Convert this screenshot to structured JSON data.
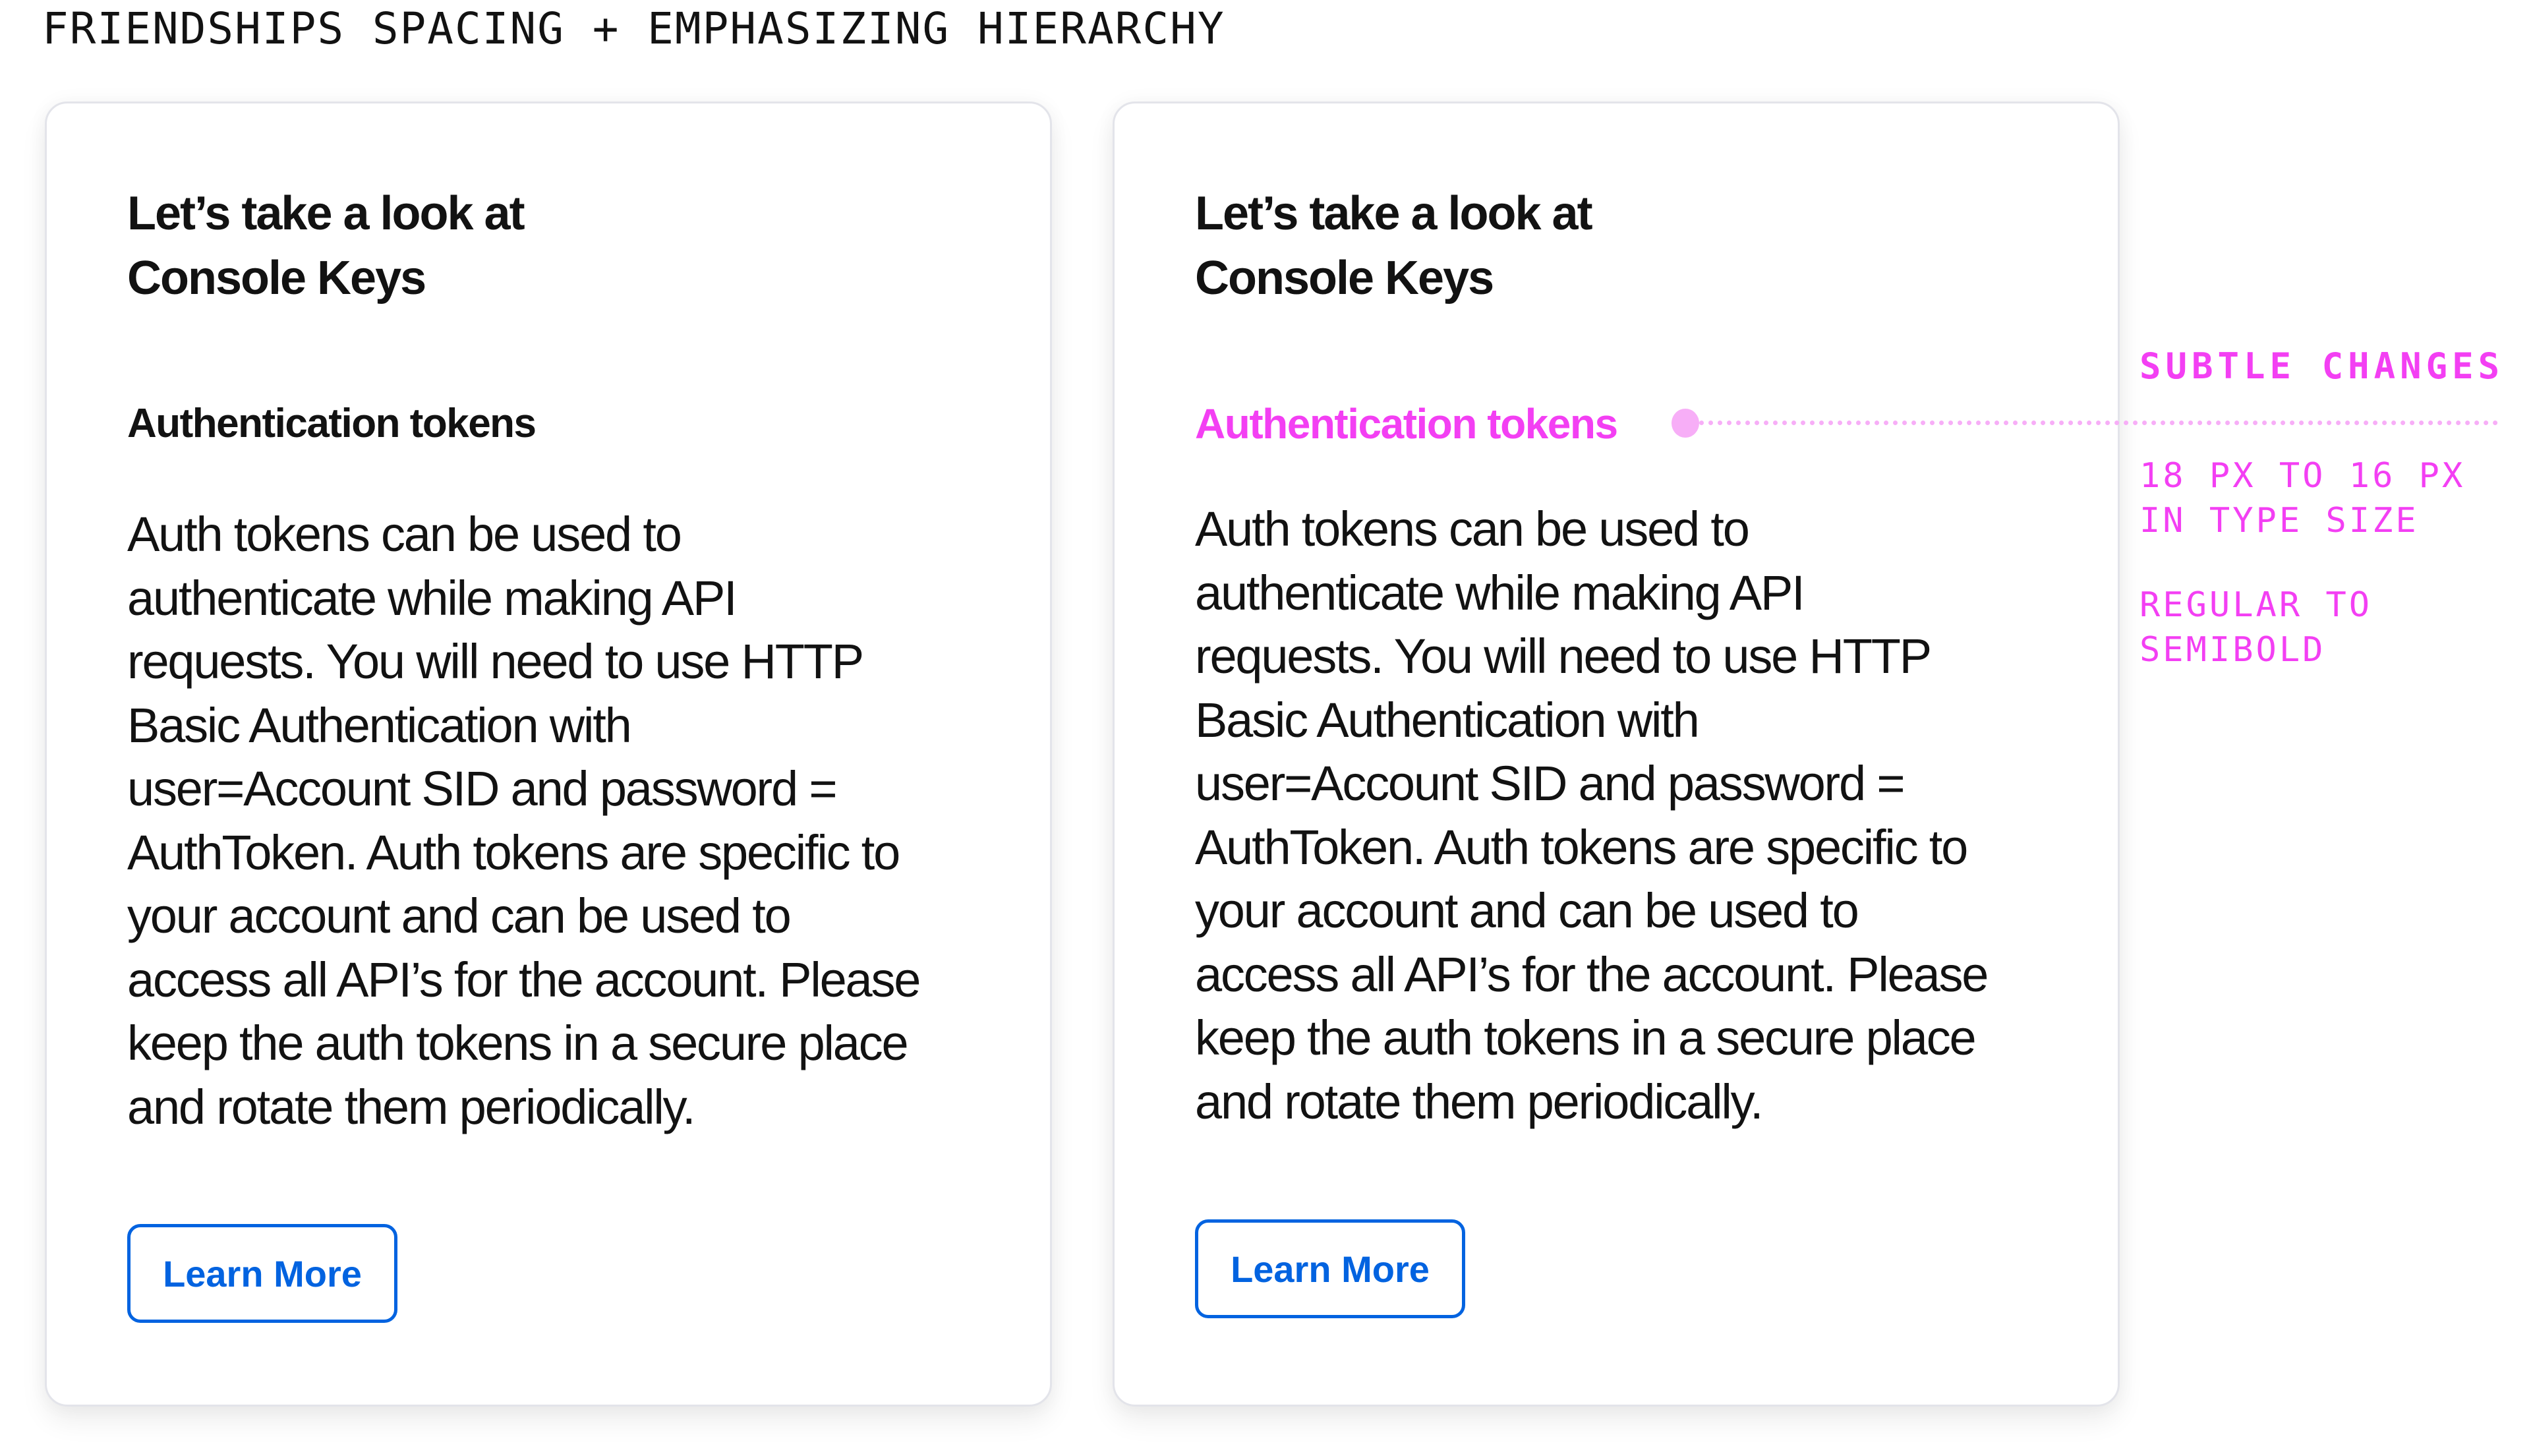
{
  "page": {
    "title": "FRIENDSHIPS SPACING + EMPHASIZING HIERARCHY"
  },
  "cards": [
    {
      "variant": "before",
      "headline_lines": [
        "Let’s take a look at",
        "Console Keys"
      ],
      "subheading": "Authentication tokens",
      "body_lines": [
        "Auth tokens can be used to",
        "authenticate while making API",
        "requests. You will need to use HTTP",
        "Basic Authentication with",
        "user=Account SID and password =",
        "AuthToken. Auth tokens are specific to",
        "your account and can be used to",
        "access all API’s for the account. Please",
        "keep the auth tokens in a secure place",
        "and rotate them periodically."
      ],
      "button_label": "Learn More"
    },
    {
      "variant": "after",
      "headline_lines": [
        "Let’s take a look at",
        "Console Keys"
      ],
      "subheading": "Authentication tokens",
      "body_lines": [
        "Auth tokens can be used to",
        "authenticate while making API",
        "requests. You will need to use HTTP",
        "Basic Authentication with",
        "user=Account SID and password =",
        "AuthToken. Auth tokens are specific to",
        "your account and can be used to",
        "access all API’s for the account. Please",
        "keep the auth tokens in a secure place",
        "and rotate them periodically."
      ],
      "button_label": "Learn More"
    }
  ],
  "annotation": {
    "title": "SUBTLE CHANGES",
    "notes": [
      [
        "18 PX TO 16 PX",
        "IN TYPE SIZE"
      ],
      [
        "REGULAR TO",
        "SEMIBOLD"
      ]
    ]
  },
  "colors": {
    "highlight": "#f33ff3",
    "highlight_light": "#f7aef7",
    "button_blue": "#0263e0",
    "text": "#121212",
    "card_border": "#e3e4ea"
  }
}
